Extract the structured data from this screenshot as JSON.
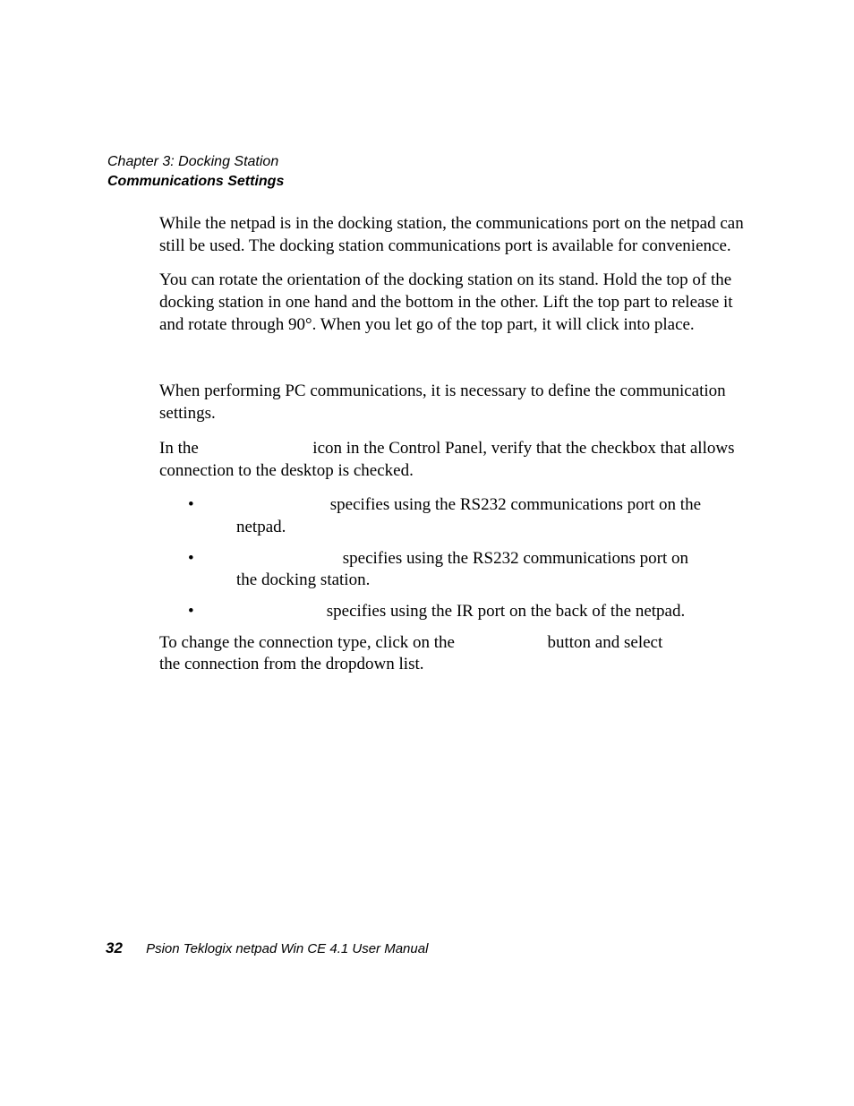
{
  "header": {
    "chapter": "Chapter 3:  Docking Station",
    "section": "Communications Settings"
  },
  "body": {
    "p1": "While the netpad is in the docking station, the communications port on the netpad can still be used. The docking station communications port is available for convenience.",
    "p2": "You can rotate the orientation of the docking station on its stand. Hold the top of the docking station in one hand and the bottom in the other. Lift the top part to release it and rotate through 90°. When you let go of the top part, it will click into place.",
    "p3": "When performing PC communications, it is necessary to define the communication settings.",
    "p4a": "In the",
    "p4b": "icon in the Control Panel, verify that the checkbox that allows connection to the desktop is checked.",
    "bullets": [
      "specifies using the RS232 communications port on the netpad.",
      "specifies using the RS232 communications port on the docking station.",
      "specifies using the IR port on the back of the netpad."
    ],
    "p5a": "To change the connection type, click on the",
    "p5b": "button and select the connection from the dropdown list."
  },
  "footer": {
    "page": "32",
    "title": "Psion Teklogix netpad Win CE 4.1 User Manual"
  }
}
